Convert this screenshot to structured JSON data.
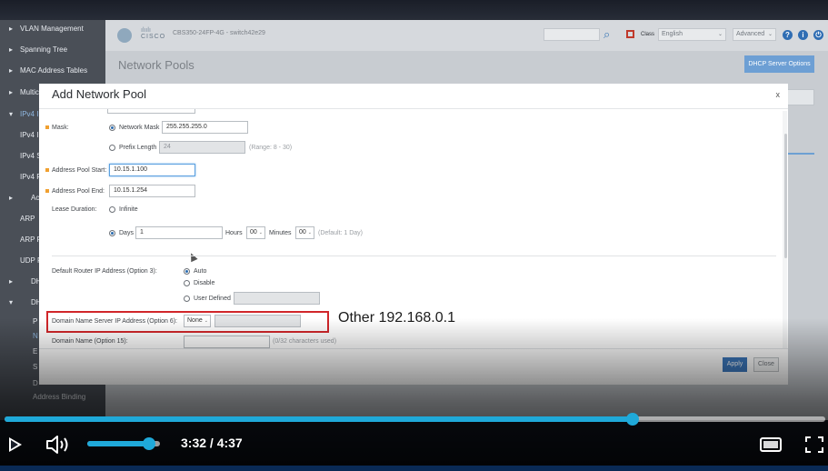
{
  "nav": {
    "items": [
      {
        "label": "VLAN Management",
        "kind": "chev"
      },
      {
        "label": "Spanning Tree",
        "kind": "chev"
      },
      {
        "label": "MAC Address Tables",
        "kind": "chev"
      },
      {
        "label": "Multic",
        "kind": "chev"
      },
      {
        "label": "IPv4 I",
        "kind": "open"
      },
      {
        "label": "IPv4 I",
        "kind": "sub"
      },
      {
        "label": "IPv4 S",
        "kind": "sub"
      },
      {
        "label": "IPv4 F",
        "kind": "sub"
      },
      {
        "label": "Ac",
        "kind": "chev-sub"
      },
      {
        "label": "ARP",
        "kind": "sub"
      },
      {
        "label": "ARP P",
        "kind": "sub"
      },
      {
        "label": "UDP R",
        "kind": "sub"
      },
      {
        "label": "DH",
        "kind": "chev-sub"
      },
      {
        "label": "DH",
        "kind": "open-sub"
      },
      {
        "label": "P",
        "kind": "sub2"
      },
      {
        "label": "N",
        "kind": "sub2"
      },
      {
        "label": "E",
        "kind": "sub2"
      },
      {
        "label": "S",
        "kind": "sub2"
      },
      {
        "label": "D",
        "kind": "sub2"
      },
      {
        "label": "Address Binding",
        "kind": "sub2"
      }
    ]
  },
  "header": {
    "brand": "CISCO",
    "device": "CBS350-24FP-4G - switch42e29",
    "class_label": "Class",
    "language": "English",
    "mode": "Advanced",
    "page_title": "Network Pools",
    "dhcp_options_button": "DHCP Server Options"
  },
  "modal": {
    "title": "Add Network Pool",
    "close": "x",
    "mask_label": "Mask:",
    "network_mask_label": "Network Mask",
    "network_mask_value": "255.255.255.0",
    "prefix_length_label": "Prefix Length",
    "prefix_length_value": "24",
    "prefix_range": "(Range: 8 - 30)",
    "pool_start_label": "Address Pool Start:",
    "pool_start_value": "10.15.1.100",
    "pool_end_label": "Address Pool End:",
    "pool_end_value": "10.15.1.254",
    "lease_label": "Lease Duration:",
    "infinite_label": "Infinite",
    "days_label": "Days",
    "days_value": "1",
    "hours_label": "Hours",
    "hours_value": "00",
    "minutes_label": "Minutes",
    "minutes_value": "00",
    "lease_default": "(Default: 1 Day)",
    "router_label": "Default Router IP Address (Option 3):",
    "router_auto": "Auto",
    "router_disable": "Disable",
    "router_user": "User Defined",
    "dns_label": "Domain Name Server IP Address (Option 6):",
    "dns_select": "None",
    "domain_label": "Domain Name (Option 15):",
    "domain_hint": "(0/32 characters used)",
    "apply": "Apply",
    "close_button": "Close"
  },
  "annotation": {
    "text": "Other 192.168.0.1"
  },
  "player": {
    "time": "3:32 / 4:37",
    "progress": 0.765,
    "volume": 0.85,
    "accent": "#1fa9d9"
  }
}
